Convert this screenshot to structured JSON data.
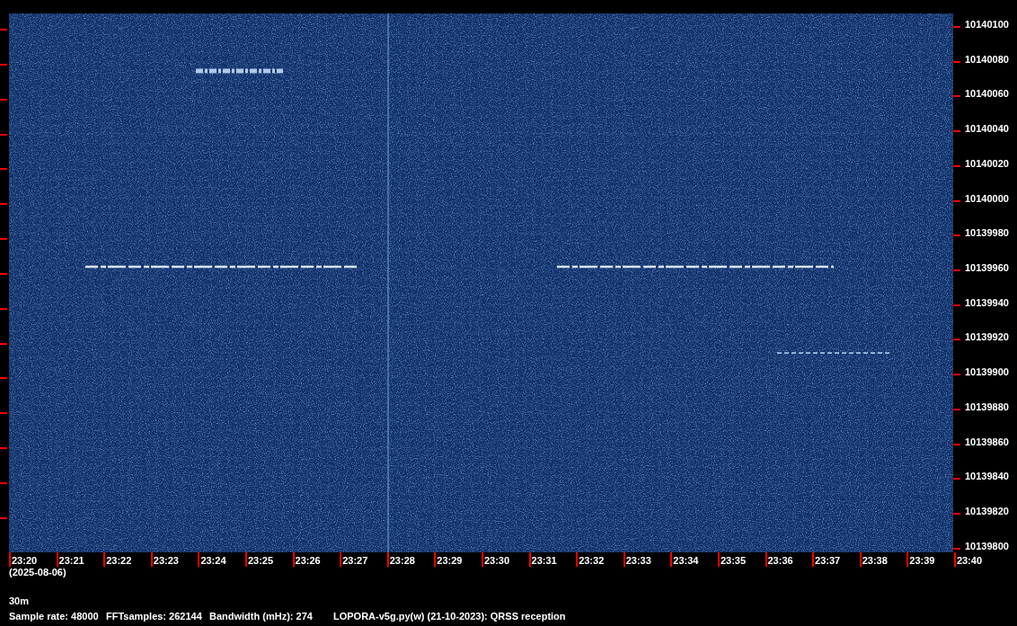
{
  "frequency_axis": {
    "labels": [
      "10140100",
      "10140080",
      "10140060",
      "10140040",
      "10140020",
      "10140000",
      "10139980",
      "10139960",
      "10139940",
      "10139920",
      "10139900",
      "10139880",
      "10139860",
      "10139840",
      "10139820",
      "10139800"
    ]
  },
  "time_axis": {
    "labels": [
      "23:20",
      "23:21",
      "23:22",
      "23:23",
      "23:24",
      "23:25",
      "23:26",
      "23:27",
      "23:28",
      "23:29",
      "23:30",
      "23:31",
      "23:32",
      "23:33",
      "23:34",
      "23:35",
      "23:36",
      "23:37",
      "23:38",
      "23:39",
      "23:40"
    ],
    "date": "(2025-08-06)"
  },
  "band": "30m",
  "info": [
    "Sample rate: 48000",
    "FFTsamples: 262144",
    "Bandwidth (mHz): 274",
    "LOPORA-v5g.py(w) (21-10-2023): QRSS reception"
  ]
}
